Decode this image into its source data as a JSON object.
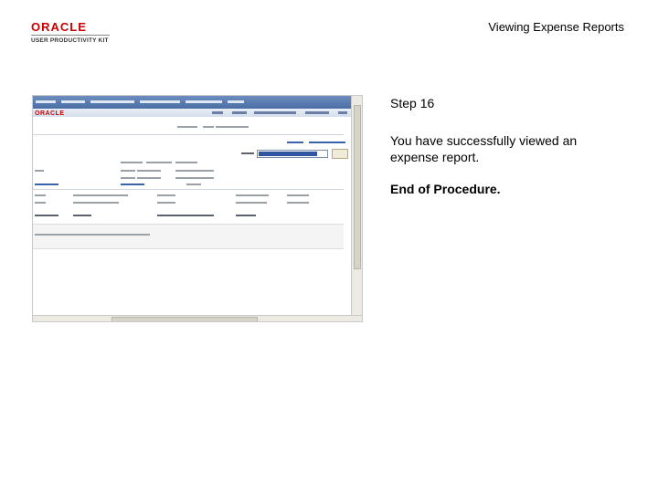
{
  "header": {
    "brand_name": "ORACLE",
    "brand_subtitle": "USER PRODUCTIVITY KIT",
    "page_title": "Viewing Expense Reports"
  },
  "screenshot": {
    "logo": "ORACLE"
  },
  "narrative": {
    "step": "Step 16",
    "text": "You have successfully viewed an expense report.",
    "end": "End of Procedure."
  }
}
